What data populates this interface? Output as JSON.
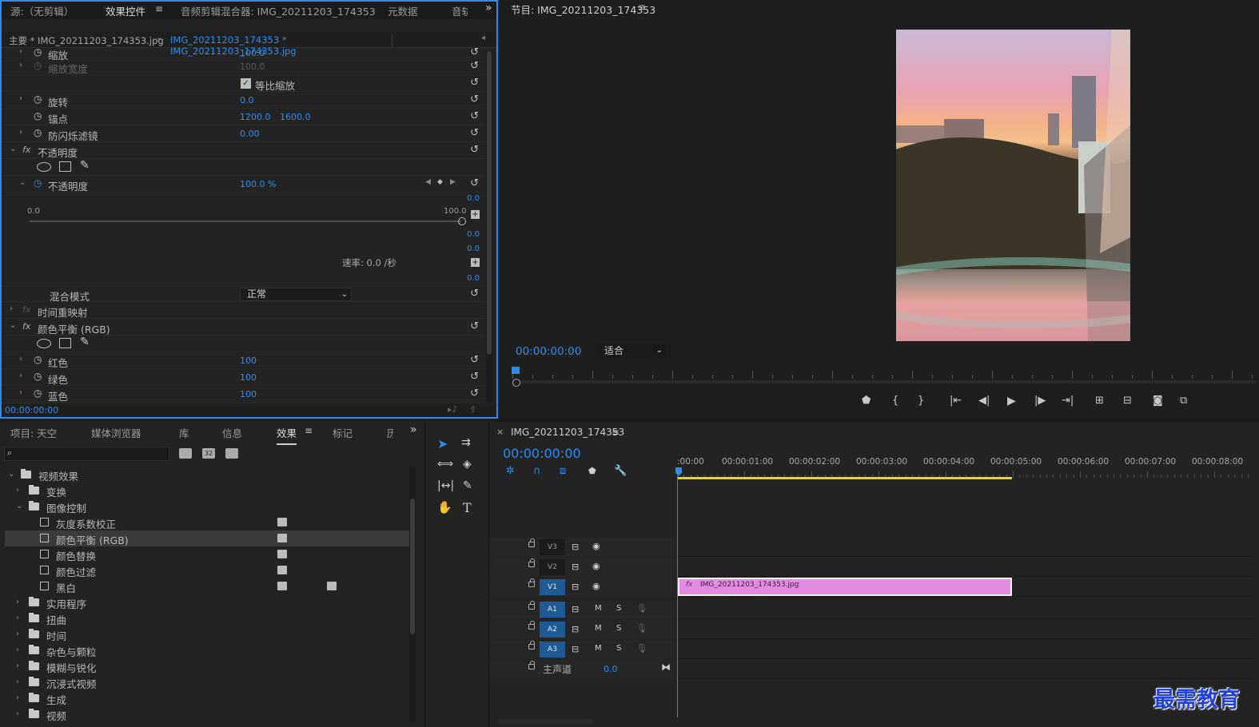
{
  "effect_controls": {
    "tabs": [
      "源:（无剪辑）",
      "效果控件",
      "音频剪辑混合器: IMG_20211203_174353",
      "元数据",
      "音轨"
    ],
    "menu_glyph": "≡",
    "master_label": "主要 * IMG_20211203_174353.jpg",
    "clip_label": "IMG_20211203_174353 * IMG_20211203_174353.jpg",
    "rows": {
      "scale_label": "缩放",
      "scale_value": "100.0",
      "scale_width_label": "缩放宽度",
      "scale_width_value": "100.0",
      "uniform_label": "等比缩放",
      "rotation_label": "旋转",
      "rotation_value": "0.0",
      "anchor_label": "锚点",
      "anchor_x": "1200.0",
      "anchor_y": "1600.0",
      "antiflicker_label": "防闪烁滤镜",
      "antiflicker_value": "0.00",
      "opacity_group": "不透明度",
      "opacity_label": "不透明度",
      "opacity_value": "100.0 %",
      "graph_val_1": "0.0",
      "graph_min": "0.0",
      "graph_max": "100.0",
      "graph_val_2": "0.0",
      "graph_val_3": "0.0",
      "graph_val_4": "0.0",
      "velocity": "速率: 0.0 /秒",
      "blend_label": "混合模式",
      "blend_value": "正常",
      "time_remap": "时间重映射",
      "color_balance": "颜色平衡 (RGB)",
      "red_label": "红色",
      "red_value": "100",
      "green_label": "绿色",
      "green_value": "100",
      "blue_label": "蓝色",
      "blue_value": "100"
    },
    "timecode": "00:00:00:00"
  },
  "program_monitor": {
    "title": "节目: IMG_20211203_174353",
    "timecode": "00:00:00:00",
    "fit_label": "适合"
  },
  "project_panel": {
    "tabs": [
      "项目: 天空",
      "媒体浏览器",
      "库",
      "信息",
      "效果",
      "标记",
      "历"
    ],
    "search_placeholder": "",
    "tree": {
      "video_effects": "视频效果",
      "transform": "变换",
      "image_control": "图像控制",
      "gamma": "灰度系数校正",
      "color_balance": "颜色平衡 (RGB)",
      "color_replace": "颜色替换",
      "color_pass": "颜色过滤",
      "bw": "黑白",
      "utility": "实用程序",
      "distort": "扭曲",
      "time": "时间",
      "noise": "杂色与颗粒",
      "blur": "模糊与锐化",
      "immersive": "沉浸式视频",
      "generate": "生成",
      "video": "视频"
    }
  },
  "timeline": {
    "sequence_name": "IMG_20211203_174353",
    "close_glyph": "×",
    "timecode": "00:00:00:00",
    "ruler": [
      ":00:00",
      "00:00:01:00",
      "00:00:02:00",
      "00:00:03:00",
      "00:00:04:00",
      "00:00:05:00",
      "00:00:06:00",
      "00:00:07:00",
      "00:00:08:00"
    ],
    "tracks": {
      "v3": "V3",
      "v2": "V2",
      "v1": "V1",
      "a1": "A1",
      "a2": "A2",
      "a3": "A3"
    },
    "mute": "M",
    "solo": "S",
    "master_label": "主声道",
    "master_value": "0.0",
    "clip_fx": "fx",
    "clip_name": "IMG_20211203_174353.jpg"
  },
  "watermark": "最需教育",
  "colors": {
    "accent": "#2d8ceb",
    "clip": "#e38ce0",
    "work_area": "#e6d322"
  }
}
